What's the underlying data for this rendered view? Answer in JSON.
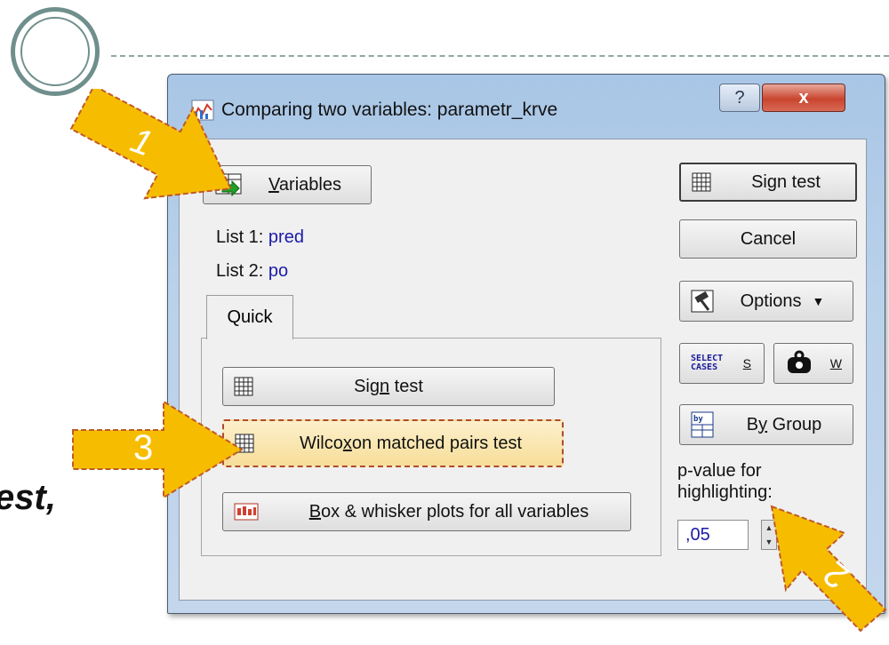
{
  "slide": {
    "partial_text": "est,"
  },
  "window": {
    "title": "Comparing two variables: parametr_krve",
    "help_label": "?",
    "close_label": "x"
  },
  "variables_button": {
    "label_pre": "",
    "label_u": "V",
    "label_post": "ariables"
  },
  "lists": {
    "list1_label": "List 1:",
    "list1_value": "pred",
    "list2_label": "List 2:",
    "list2_value": "po"
  },
  "tabs": [
    {
      "label": "Quick"
    }
  ],
  "quick": {
    "sign_test": {
      "label_pre": "Sig",
      "label_u": "n",
      "label_post": " test"
    },
    "wilcoxon": {
      "label_pre": "Wilco",
      "label_u": "x",
      "label_post": "on matched pairs test"
    },
    "box_whisker": {
      "label_pre": "",
      "label_u": "B",
      "label_post": "ox & whisker plots for all variables"
    }
  },
  "side": {
    "sign_test_label": "Sign test",
    "cancel_label": "Cancel",
    "options_label": "Options",
    "select_cases_icon_text": "SELECT CASES",
    "select_cases_key": "S",
    "weights_key": "W",
    "by_group": {
      "label_pre": "B",
      "label_u": "y",
      "label_post": " Group"
    },
    "pvalue_label_line1": "p-value for",
    "pvalue_label_line2": "highlighting:",
    "pvalue_value": ",05"
  },
  "annotations": [
    {
      "label": "1"
    },
    {
      "label": "2"
    },
    {
      "label": "3"
    }
  ],
  "colors": {
    "arrow_fill": "#f6bd00",
    "arrow_border": "#c05a28",
    "list_value": "#1a1aaa",
    "highlight_fill": "#f8e3a6"
  }
}
